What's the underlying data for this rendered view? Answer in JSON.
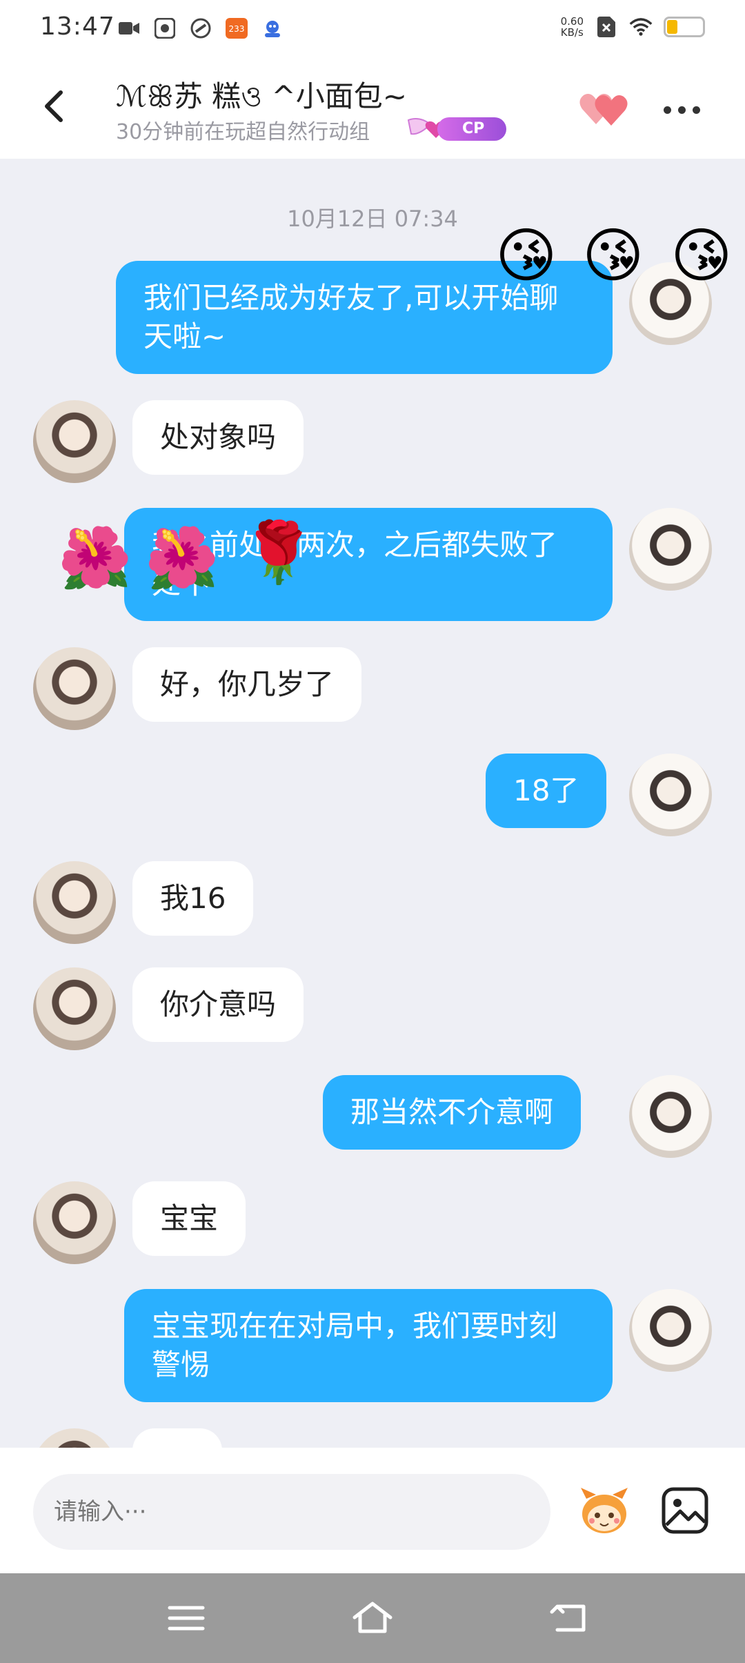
{
  "status_bar": {
    "time": "13:47",
    "net_speed_value": "0.60",
    "net_speed_unit": "KB/s",
    "badge_233": "233",
    "battery_level": 0.3
  },
  "header": {
    "title": "ℳꕥ苏 糕ও ^小面包~",
    "subtitle": "30分钟前在玩超自然行动组",
    "cp_label": "CP"
  },
  "chat": {
    "timestamp": "10月12日 07:34",
    "messages": [
      {
        "side": "out",
        "text": "我们已经成为好友了,可以开始聊天啦~"
      },
      {
        "side": "in",
        "text": "处对象吗"
      },
      {
        "side": "out",
        "text": "我之前处过两次，之后都失败了处不"
      },
      {
        "side": "in",
        "text": "好，你几岁了"
      },
      {
        "side": "out",
        "text": "18了"
      },
      {
        "side": "in",
        "text": "我16"
      },
      {
        "side": "in",
        "text": "你介意吗"
      },
      {
        "side": "out",
        "text": "那当然不介意啊"
      },
      {
        "side": "in",
        "text": "宝宝"
      },
      {
        "side": "out",
        "text": "宝宝现在在对局中，我们要时刻警惕"
      }
    ],
    "floating_emojis": [
      "😘",
      "😘",
      "😘",
      "🌺",
      "🌺",
      "🌹"
    ]
  },
  "input": {
    "placeholder": "请输入···"
  },
  "icons": {
    "back": "chevron-left-icon",
    "heart": "double-heart-icon",
    "more": "more-dots-icon",
    "mascot": "mascot-sticker-icon",
    "image": "image-icon",
    "nav_menu": "menu-icon",
    "nav_home": "home-icon",
    "nav_back": "return-icon"
  },
  "colors": {
    "outgoing_bubble": "#2ab0ff",
    "incoming_bubble": "#ffffff",
    "chat_background": "#eeeff5",
    "cp_badge": "#c35be3",
    "heart": "#f2737e"
  }
}
